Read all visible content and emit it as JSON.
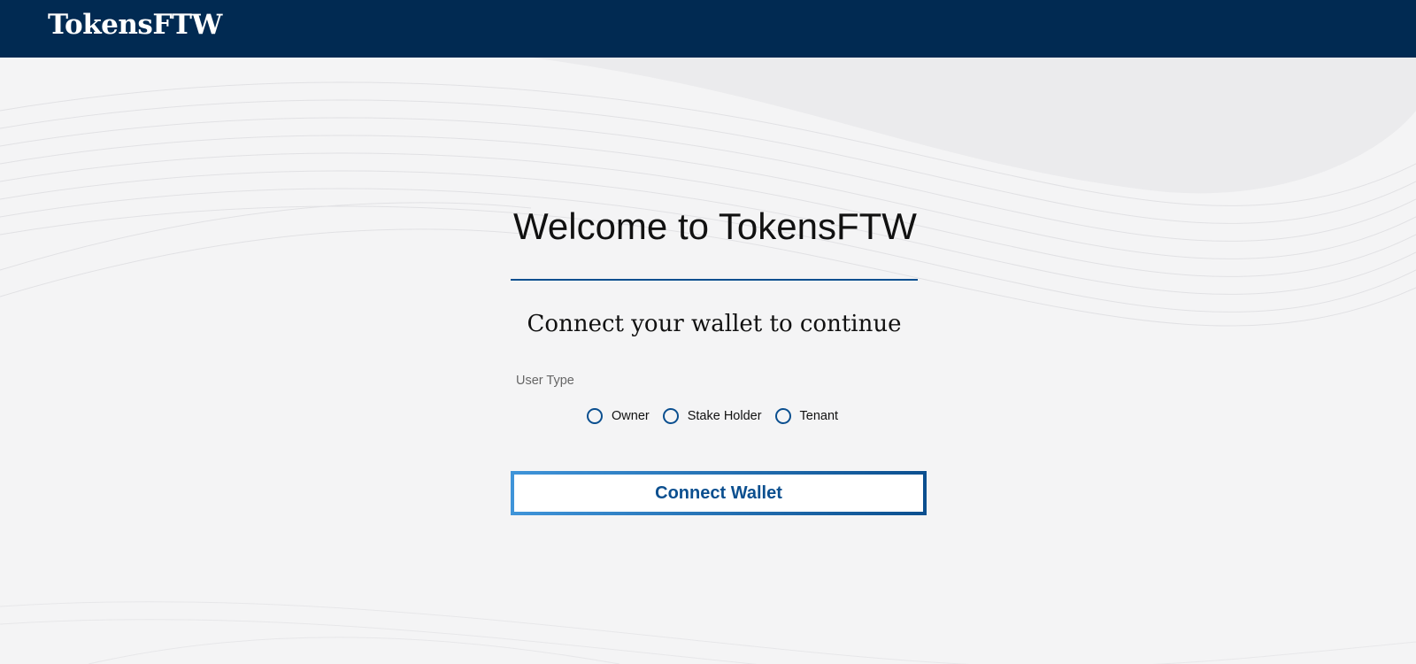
{
  "header": {
    "brand": "TokensFTW"
  },
  "main": {
    "title": "Welcome to TokensFTW",
    "subtitle": "Connect your wallet to continue",
    "user_type": {
      "label": "User Type",
      "options": [
        "Owner",
        "Stake Holder",
        "Tenant"
      ],
      "selected": null
    },
    "connect_button_label": "Connect Wallet"
  },
  "colors": {
    "header_bg": "#012a52",
    "accent": "#0b4f8f",
    "button_gradient_start": "#3f94d9",
    "page_bg": "#f4f4f5"
  }
}
